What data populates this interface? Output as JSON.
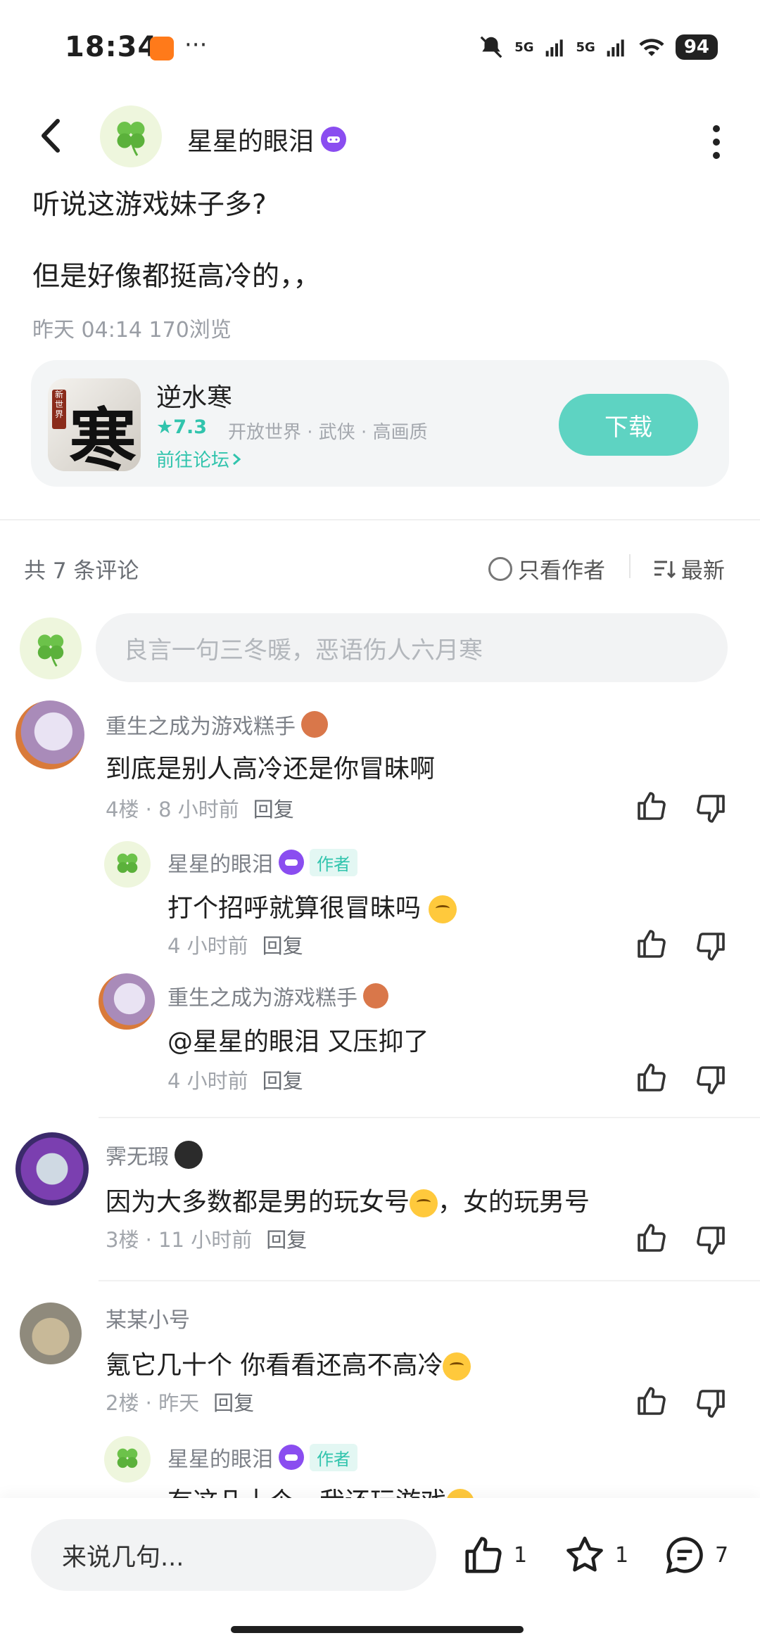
{
  "status": {
    "time": "18:34",
    "more": "···",
    "battery": "94",
    "net1": "5G",
    "net2": "5G"
  },
  "post": {
    "author": "星星的眼泪",
    "title": "听说这游戏妹子多?",
    "body": "但是好像都挺高冷的，，",
    "meta": "昨天 04:14  170浏览"
  },
  "game": {
    "name": "逆水寒",
    "rating": "7.3",
    "tags": "开放世界 · 武侠 · 高画质",
    "forum_link": "前往论坛",
    "download_label": "下载",
    "icon_text": "寒",
    "icon_sub": "新世界"
  },
  "comments_header": {
    "count": "共 7 条评论",
    "only_author": "只看作者",
    "sort": "最新"
  },
  "comment_input": {
    "placeholder": "良言一句三冬暖，恶语伤人六月寒"
  },
  "comments": [
    {
      "name": "重生之成为游戏糕手",
      "text": "到底是别人高冷还是你冒昧啊",
      "meta": "4楼 · 8 小时前",
      "reply": "回复",
      "replies": [
        {
          "name": "星星的眼泪",
          "tag": "作者",
          "text": "打个招呼就算很冒昧吗",
          "meta": "4 小时前",
          "reply": "回复"
        },
        {
          "name": "重生之成为游戏糕手",
          "text": "@星星的眼泪  又压抑了",
          "meta": "4 小时前",
          "reply": "回复"
        }
      ]
    },
    {
      "name": "霁无瑕",
      "text": "因为大多数都是男的玩女号",
      "text_tail": "，女的玩男号",
      "meta": "3楼 · 11 小时前",
      "reply": "回复"
    },
    {
      "name": "某某小号",
      "text": "氪它几十个 你看看还高不高冷",
      "meta": "2楼 · 昨天",
      "reply": "回复",
      "replies": [
        {
          "name": "星星的眼泪",
          "tag": "作者",
          "text": "有这几十个，我还玩游戏"
        }
      ]
    }
  ],
  "bottom": {
    "placeholder": "来说几句...",
    "likes": "1",
    "stars": "1",
    "comments": "7"
  },
  "colors": {
    "accent": "#5ed3c2",
    "accent_text": "#31c4ad",
    "badge": "#8a4df0"
  }
}
